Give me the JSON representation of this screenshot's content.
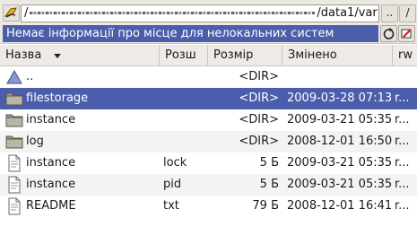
{
  "window": {
    "path_prefix": "/",
    "path_suffix": "/data1/var",
    "up_label": "..",
    "root_label": "/"
  },
  "status": {
    "text": "Немає інформації про місце для нелокальних систем"
  },
  "columns": {
    "name": "Назва",
    "ext": "Розш",
    "size": "Розмір",
    "date": "Змінено",
    "perm": "rw"
  },
  "rows": [
    {
      "icon": "parent-dir-icon",
      "name": "..",
      "ext": "",
      "size": "<DIR>",
      "date": "",
      "perm": ""
    },
    {
      "icon": "folder-icon",
      "name": "filestorage",
      "ext": "",
      "size": "<DIR>",
      "date": "2009-03-28 07:13",
      "perm": "r..."
    },
    {
      "icon": "folder-icon",
      "name": "instance",
      "ext": "",
      "size": "<DIR>",
      "date": "2009-03-21 05:35",
      "perm": "r..."
    },
    {
      "icon": "folder-icon",
      "name": "log",
      "ext": "",
      "size": "<DIR>",
      "date": "2008-12-01 16:50",
      "perm": "r..."
    },
    {
      "icon": "file-icon",
      "name": "instance",
      "ext": "lock",
      "size": "5 Б",
      "date": "2009-03-21 05:35",
      "perm": "r..."
    },
    {
      "icon": "file-icon",
      "name": "instance",
      "ext": "pid",
      "size": "5 Б",
      "date": "2009-03-21 05:35",
      "perm": "r..."
    },
    {
      "icon": "file-icon",
      "name": "README",
      "ext": "txt",
      "size": "79 Б",
      "date": "2008-12-01 16:41",
      "perm": "r..."
    }
  ],
  "selected_row": 1,
  "colors": {
    "selection": "#4b5eab",
    "chrome": "#ece9e4"
  }
}
